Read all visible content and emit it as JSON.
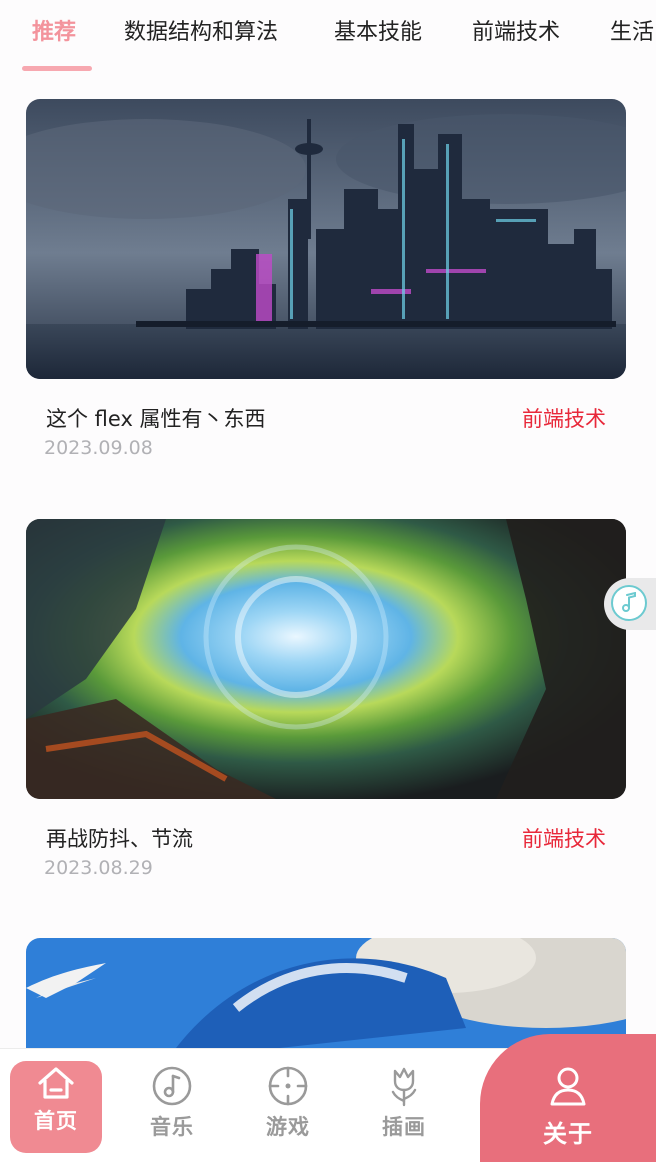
{
  "tabs": [
    {
      "label": "推荐"
    },
    {
      "label": "数据结构和算法"
    },
    {
      "label": "基本技能"
    },
    {
      "label": "前端技术"
    },
    {
      "label": "生活"
    }
  ],
  "posts": [
    {
      "title": "这个 flex 属性有丶东西",
      "tag": "前端技术",
      "date": "2023.09.08"
    },
    {
      "title": "再战防抖、节流",
      "tag": "前端技术",
      "date": "2023.08.29"
    }
  ],
  "nav": {
    "home": "首页",
    "music": "音乐",
    "game": "游戏",
    "illustration": "插画",
    "about": "关于"
  },
  "colors": {
    "accent": "#f08a92",
    "tag": "#e8283a",
    "about_bg": "#e86f7c"
  },
  "icons": [
    "home-icon",
    "music-icon",
    "crosshair-icon",
    "tulip-icon",
    "user-icon",
    "music-note-icon"
  ]
}
